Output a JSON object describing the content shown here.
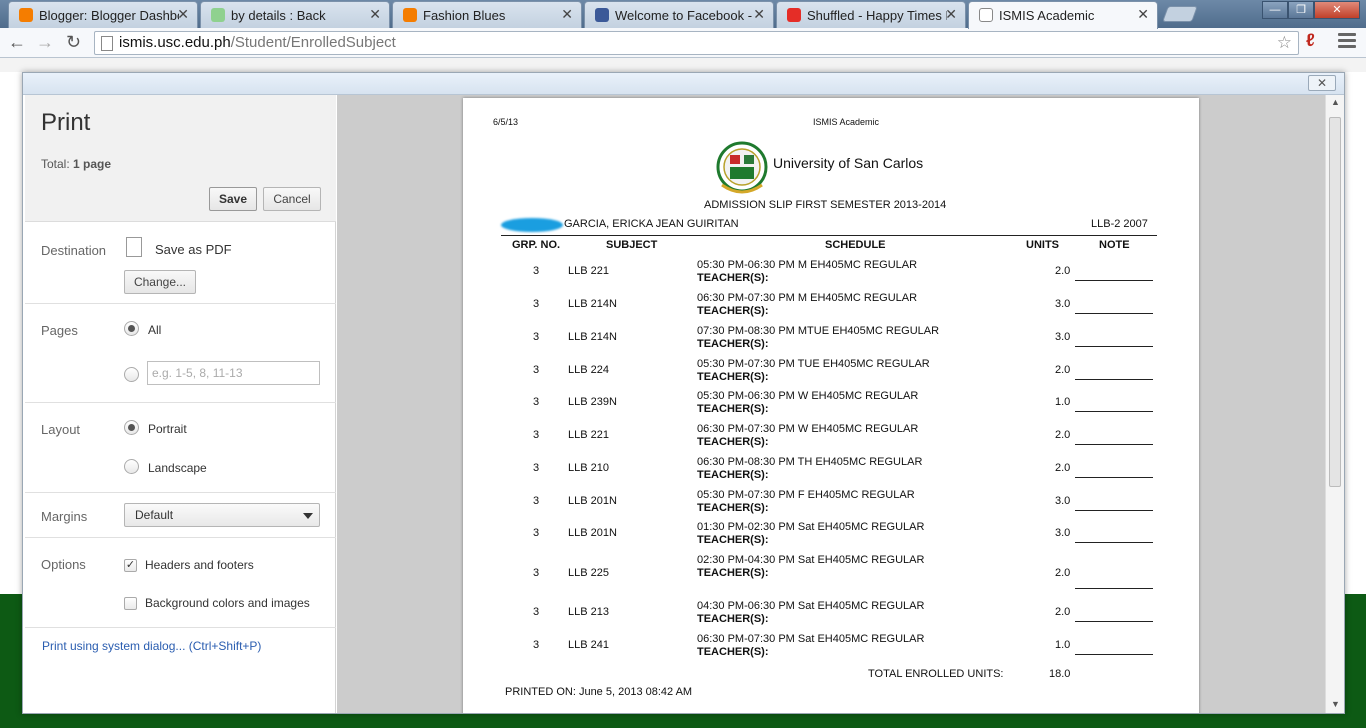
{
  "browser": {
    "tabs": [
      {
        "title": "Blogger: Blogger Dashboa",
        "icon": "blogger-icon",
        "color": "#f57d00"
      },
      {
        "title": "by details : Back",
        "icon": "globe-icon",
        "color": "#8fd18f"
      },
      {
        "title": "Fashion Blues",
        "icon": "blogger-icon",
        "color": "#f57d00"
      },
      {
        "title": "Welcome to Facebook - Lo",
        "icon": "facebook-icon",
        "color": "#3b5998"
      },
      {
        "title": "Shuffled - Happy Times Fo",
        "icon": "youtube-icon",
        "color": "#e52d27"
      },
      {
        "title": "ISMIS Academic",
        "icon": "page-icon",
        "color": "#ffffff",
        "active": true
      }
    ],
    "url_host": "ismis.usc.edu.ph",
    "url_path": "/Student/EnrolledSubject"
  },
  "print": {
    "title": "Print",
    "total_label": "Total:",
    "total_value": "1 page",
    "save": "Save",
    "cancel": "Cancel",
    "destination_label": "Destination",
    "destination_value": "Save as PDF",
    "change": "Change...",
    "pages_label": "Pages",
    "pages_all": "All",
    "pages_placeholder": "e.g. 1-5, 8, 11-13",
    "layout_label": "Layout",
    "portrait": "Portrait",
    "landscape": "Landscape",
    "margins_label": "Margins",
    "margins_value": "Default",
    "options_label": "Options",
    "headers_footers": "Headers and footers",
    "background": "Background colors and images",
    "system_dialog": "Print using system dialog... (Ctrl+Shift+P)"
  },
  "document": {
    "date": "6/5/13",
    "header_title": "ISMIS Academic",
    "university": "University of San Carlos",
    "slip_title": "ADMISSION SLIP FIRST SEMESTER 2013-2014",
    "student_name": "GARCIA, ERICKA JEAN GUIRITAN",
    "course": "LLB-2 2007",
    "columns": [
      "GRP. NO.",
      "SUBJECT",
      "SCHEDULE",
      "UNITS",
      "NOTE"
    ],
    "teacher_label": "TEACHER(S):",
    "rows": [
      {
        "grp": "3",
        "subject": "LLB 221",
        "schedule": "05:30 PM-06:30 PM M EH405MC REGULAR",
        "units": "2.0"
      },
      {
        "grp": "3",
        "subject": "LLB 214N",
        "schedule": "06:30 PM-07:30 PM M EH405MC REGULAR",
        "units": "3.0"
      },
      {
        "grp": "3",
        "subject": "LLB 214N",
        "schedule": "07:30 PM-08:30 PM MTUE EH405MC REGULAR",
        "units": "3.0"
      },
      {
        "grp": "3",
        "subject": "LLB 224",
        "schedule": "05:30 PM-07:30 PM TUE EH405MC REGULAR",
        "units": "2.0"
      },
      {
        "grp": "3",
        "subject": "LLB 239N",
        "schedule": "05:30 PM-06:30 PM W EH405MC REGULAR",
        "units": "1.0"
      },
      {
        "grp": "3",
        "subject": "LLB 221",
        "schedule": "06:30 PM-07:30 PM W EH405MC REGULAR",
        "units": "2.0"
      },
      {
        "grp": "3",
        "subject": "LLB 210",
        "schedule": "06:30 PM-08:30 PM TH EH405MC REGULAR",
        "units": "2.0"
      },
      {
        "grp": "3",
        "subject": "LLB 201N",
        "schedule": "05:30 PM-07:30 PM F EH405MC REGULAR",
        "units": "3.0"
      },
      {
        "grp": "3",
        "subject": "LLB 201N",
        "schedule": "01:30 PM-02:30 PM Sat EH405MC REGULAR",
        "units": "3.0"
      },
      {
        "grp": "3",
        "subject": "LLB 225",
        "schedule": "02:30 PM-04:30 PM Sat EH405MC REGULAR",
        "units": "2.0"
      },
      {
        "grp": "3",
        "subject": "LLB 213",
        "schedule": "04:30 PM-06:30 PM Sat EH405MC REGULAR",
        "units": "2.0"
      },
      {
        "grp": "3",
        "subject": "LLB 241",
        "schedule": "06:30 PM-07:30 PM Sat EH405MC REGULAR",
        "units": "1.0"
      }
    ],
    "total_label": "TOTAL ENROLLED UNITS:",
    "total_units": "18.0",
    "printed_on": "PRINTED ON: June 5, 2013 08:42 AM"
  }
}
